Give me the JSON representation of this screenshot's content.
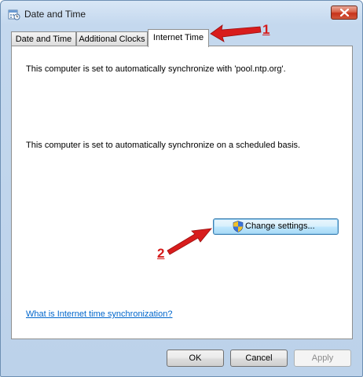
{
  "window": {
    "title": "Date and Time"
  },
  "tabs": [
    {
      "label": "Date and Time",
      "active": false
    },
    {
      "label": "Additional Clocks",
      "active": false
    },
    {
      "label": "Internet Time",
      "active": true
    }
  ],
  "internet_time": {
    "sync_server_text": "This computer is set to automatically synchronize with 'pool.ntp.org'.",
    "schedule_text": "This computer is set to automatically synchronize on a scheduled basis.",
    "change_settings_label": "Change settings...",
    "help_link": "What is Internet time synchronization?"
  },
  "buttons": {
    "ok": "OK",
    "cancel": "Cancel",
    "apply": "Apply"
  },
  "annotations": [
    {
      "number": "1",
      "color": "#d51a1a"
    },
    {
      "number": "2",
      "color": "#d51a1a"
    }
  ],
  "icons": {
    "title": "calendar-clock-icon",
    "close": "close-icon",
    "uac": "uac-shield-icon"
  }
}
